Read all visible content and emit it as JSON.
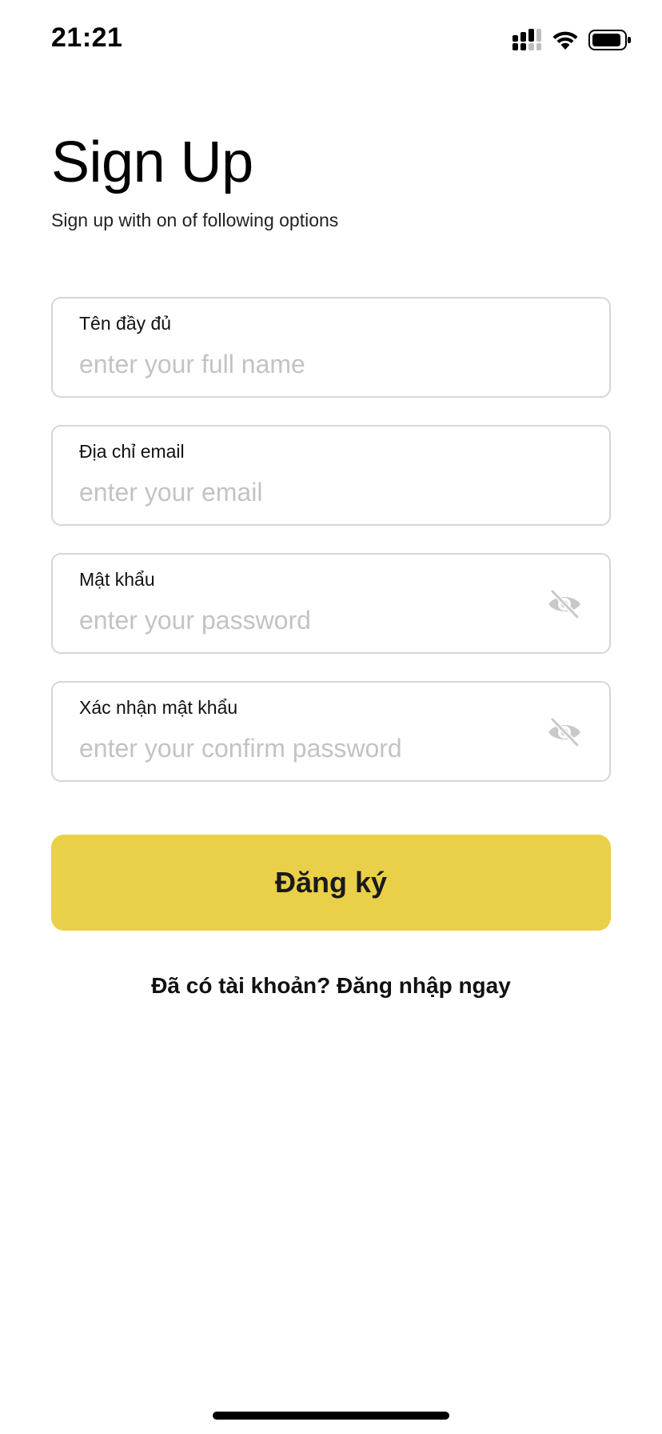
{
  "status_bar": {
    "time": "21:21",
    "signal_icon": "cellular-signal-icon",
    "wifi_icon": "wifi-icon",
    "battery_icon": "battery-icon"
  },
  "header": {
    "title": "Sign Up",
    "subtitle": "Sign up with on of following options"
  },
  "form": {
    "full_name": {
      "label": "Tên đầy đủ",
      "placeholder": "enter your full name",
      "value": ""
    },
    "email": {
      "label": "Địa chỉ email",
      "placeholder": "enter your email",
      "value": ""
    },
    "password": {
      "label": "Mật khẩu",
      "placeholder": "enter your password",
      "value": "",
      "toggle_icon": "eye-off-icon"
    },
    "confirm_password": {
      "label": "Xác nhận mật khẩu",
      "placeholder": "enter your confirm password",
      "value": "",
      "toggle_icon": "eye-off-icon"
    },
    "submit_label": "Đăng ký",
    "login_prompt": "Đã có tài khoản? Đăng nhập ngay"
  },
  "colors": {
    "accent": "#e9d048",
    "field_border": "#d6d6d6",
    "placeholder": "#c3c3c3",
    "icon_muted": "#c9c9c9"
  }
}
